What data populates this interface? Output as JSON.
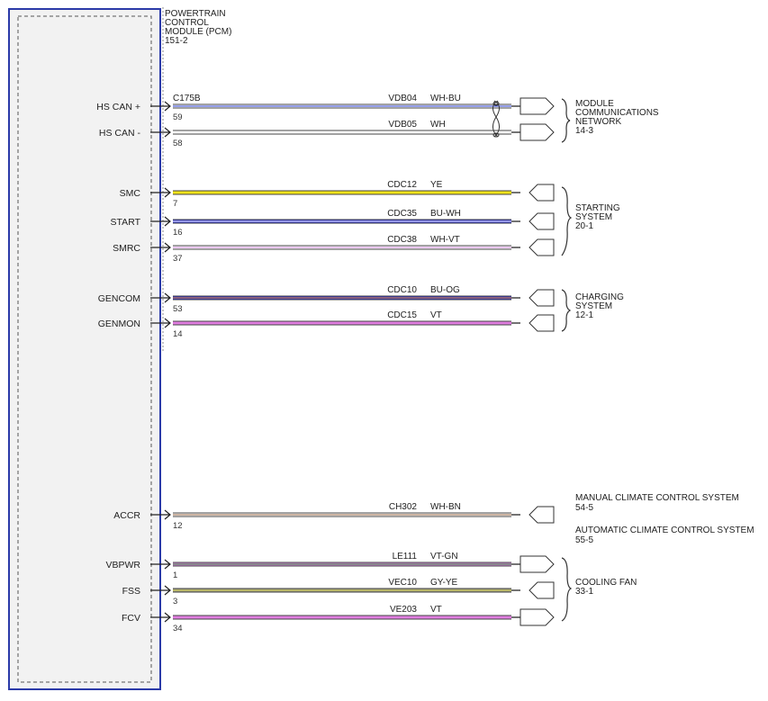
{
  "module": {
    "title_lines": [
      "POWERTRAIN",
      "CONTROL",
      "MODULE (PCM)",
      "151-2"
    ],
    "connector": "C175B"
  },
  "circuits": [
    {
      "pin_label": "HS CAN +",
      "pin": "59",
      "circuit": "VDB04",
      "color_code": "WH-BU",
      "colors": [
        "#ffffff",
        "#2b3fd6"
      ],
      "twisted": true
    },
    {
      "pin_label": "HS CAN -",
      "pin": "58",
      "circuit": "VDB05",
      "color_code": "WH",
      "colors": [
        "#ffffff"
      ],
      "twisted": true
    },
    {
      "pin_label": "SMC",
      "pin": "7",
      "circuit": "CDC12",
      "color_code": "YE",
      "colors": [
        "#f2e21a"
      ]
    },
    {
      "pin_label": "START",
      "pin": "16",
      "circuit": "CDC35",
      "color_code": "BU-WH",
      "colors": [
        "#2b2fd0",
        "#ffffff"
      ]
    },
    {
      "pin_label": "SMRC",
      "pin": "37",
      "circuit": "CDC38",
      "color_code": "WH-VT",
      "colors": [
        "#ffffff",
        "#d58ee0"
      ]
    },
    {
      "pin_label": "GENCOM",
      "pin": "53",
      "circuit": "CDC10",
      "color_code": "BU-OG",
      "colors": [
        "#2b2fd0",
        "#e8902a"
      ]
    },
    {
      "pin_label": "GENMON",
      "pin": "14",
      "circuit": "CDC15",
      "color_code": "VT",
      "colors": [
        "#e07ee0"
      ]
    },
    {
      "pin_label": "ACCR",
      "pin": "12",
      "circuit": "CH302",
      "color_code": "WH-BN",
      "colors": [
        "#ffffff",
        "#9b6a45"
      ]
    },
    {
      "pin_label": "VBPWR",
      "pin": "1",
      "circuit": "LE111",
      "color_code": "VT-GN",
      "colors": [
        "#d884e0",
        "#3a8a3a"
      ]
    },
    {
      "pin_label": "FSS",
      "pin": "3",
      "circuit": "VEC10",
      "color_code": "GY-YE",
      "colors": [
        "#9a9a84",
        "#d6d24a"
      ]
    },
    {
      "pin_label": "FCV",
      "pin": "34",
      "circuit": "VE203",
      "color_code": "VT",
      "colors": [
        "#e07ee0"
      ]
    }
  ],
  "destinations": [
    {
      "lines": [
        "MODULE",
        "COMMUNICATIONS",
        "NETWORK",
        "14-3"
      ]
    },
    {
      "lines": [
        "STARTING",
        "SYSTEM",
        "20-1"
      ]
    },
    {
      "lines": [
        "CHARGING",
        "SYSTEM",
        "12-1"
      ]
    },
    {
      "lines": [
        "MANUAL CLIMATE CONTROL SYSTEM",
        "54-5"
      ]
    },
    {
      "lines": [
        "AUTOMATIC CLIMATE CONTROL SYSTEM",
        "55-5"
      ]
    },
    {
      "lines": [
        "COOLING FAN",
        "33-1"
      ]
    }
  ],
  "colors": {
    "module_border": "#2b3aa8",
    "module_fill": "#f2f2f2"
  }
}
